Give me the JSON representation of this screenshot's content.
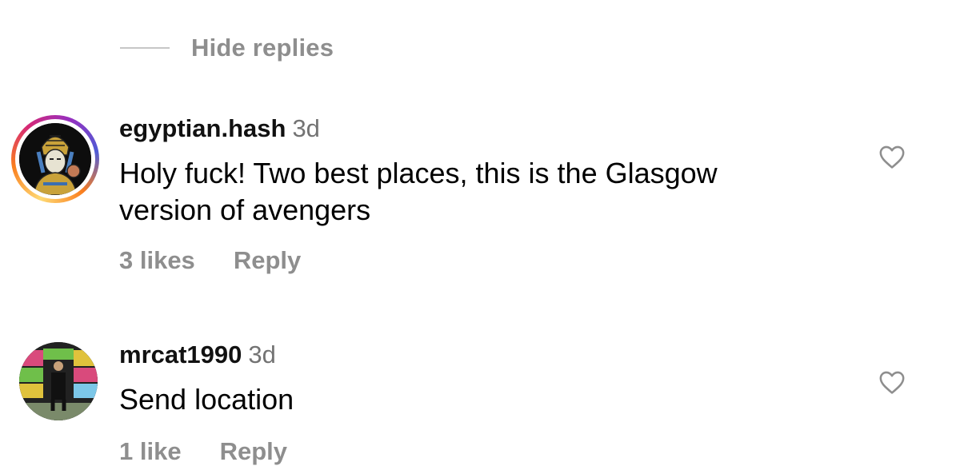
{
  "thread": {
    "hide_replies_label": "Hide replies"
  },
  "comments": [
    {
      "username": "egyptian.hash",
      "time": "3d",
      "text_line1": "Holy fuck! Two best places, this is the Glasgow",
      "text_line2": "version of avengers",
      "likes": "3 likes",
      "reply_label": "Reply",
      "avatar_has_story_ring": true
    },
    {
      "username": "mrcat1990",
      "time": "3d",
      "text_line1": "Send location",
      "likes": "1 like",
      "reply_label": "Reply",
      "avatar_has_story_ring": false
    }
  ],
  "icons": {
    "like": "heart-outline-icon",
    "story_ring": "gradient-ring"
  },
  "colors": {
    "muted": "#8e8e8e",
    "text": "#000000",
    "time": "#737373"
  }
}
